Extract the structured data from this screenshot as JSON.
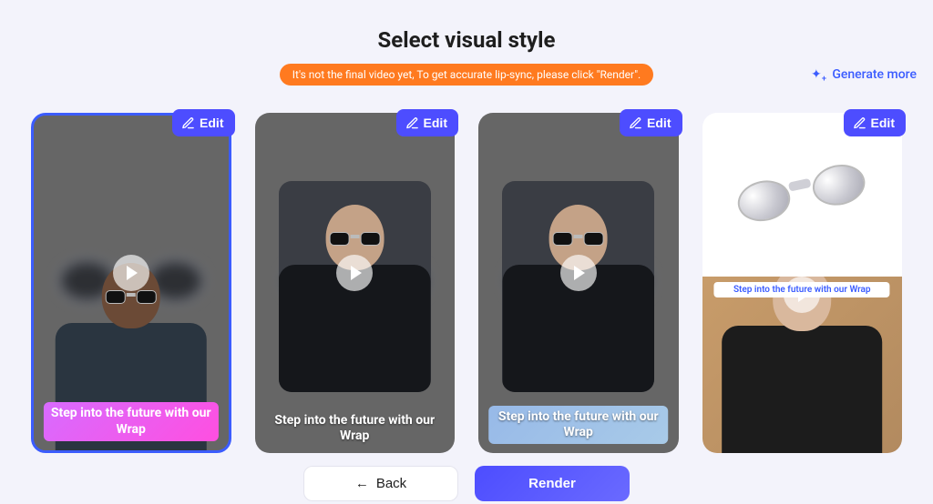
{
  "page": {
    "title": "Select visual style",
    "info": "It's not the final video yet, To get accurate lip-sync, please click \"Render\"."
  },
  "actions": {
    "generate_more": "Generate more",
    "back": "Back",
    "render": "Render"
  },
  "cards": [
    {
      "edit_label": "Edit",
      "caption": "Step into the future with our Wrap"
    },
    {
      "edit_label": "Edit",
      "caption": "Step into the future with our Wrap"
    },
    {
      "edit_label": "Edit",
      "caption": "Step into the future with our Wrap"
    },
    {
      "edit_label": "Edit",
      "caption": "Step into the future with our Wrap"
    }
  ]
}
